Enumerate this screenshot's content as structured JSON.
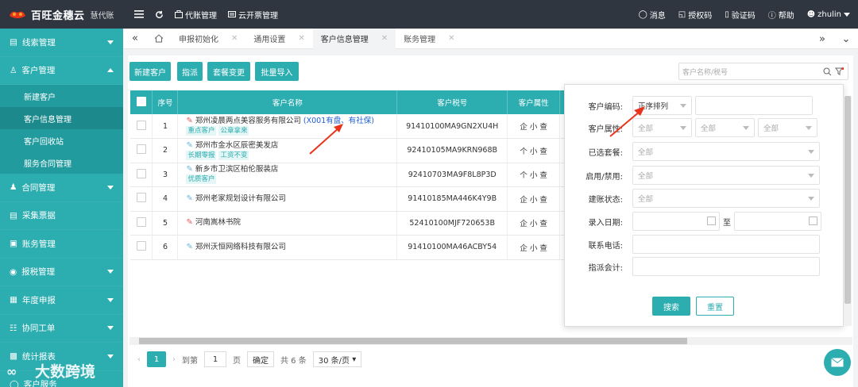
{
  "brand": {
    "name": "百旺金穗云",
    "sub": "慧代账"
  },
  "topnav": [
    {
      "icon": "menu-icon",
      "label": ""
    },
    {
      "icon": "refresh-icon",
      "label": ""
    },
    {
      "icon": "briefcase-icon",
      "label": "代账管理"
    },
    {
      "icon": "invoice-icon",
      "label": "云开票管理"
    }
  ],
  "topright": {
    "messages": "消息",
    "auth_code": "授权码",
    "verify_code": "验证码",
    "help": "帮助",
    "user": "zhulin"
  },
  "sidebar": {
    "items": [
      {
        "label": "线索管理",
        "icon": "clue-icon"
      },
      {
        "label": "客户管理",
        "icon": "user-group-icon",
        "expanded": true
      },
      {
        "label": "合同管理",
        "icon": "contract-icon"
      },
      {
        "label": "采集票据",
        "icon": "ticket-icon"
      },
      {
        "label": "账务管理",
        "icon": "ledger-icon"
      },
      {
        "label": "报税管理",
        "icon": "tax-icon"
      },
      {
        "label": "年度申报",
        "icon": "calendar-icon"
      },
      {
        "label": "协同工单",
        "icon": "workorder-icon"
      },
      {
        "label": "统计报表",
        "icon": "chart-icon"
      },
      {
        "label": "客户服务",
        "icon": "service-icon"
      }
    ],
    "subitems": [
      "新建客户",
      "客户信息管理",
      "客户回收站",
      "服务合同管理"
    ]
  },
  "tabs": [
    {
      "label": "申报初始化"
    },
    {
      "label": "通用设置"
    },
    {
      "label": "客户信息管理",
      "active": true
    },
    {
      "label": "账务管理"
    }
  ],
  "toolbar": {
    "new_customer": "新建客户",
    "assign": "指派",
    "package_change": "套餐变更",
    "batch_import": "批量导入",
    "search_placeholder": "客户名称/税号"
  },
  "table": {
    "headers": [
      "序号",
      "客户名称",
      "客户税号",
      "客户属性"
    ],
    "rows": [
      {
        "no": "1",
        "name": "郑州凌晨两点美容服务有限公司",
        "extra": "(X001有盘、有社保)",
        "tags": [
          "重点客户",
          "公章拿来"
        ],
        "tax": "91410100MA9GN2XU4H",
        "attr": "企 小 查",
        "icon": "red"
      },
      {
        "no": "2",
        "name": "郑州市金水区辰密美发店",
        "extra": "",
        "tags": [
          "长期零报",
          "工资不变"
        ],
        "tax": "92410105MA9KRN968B",
        "attr": "个 小 查",
        "icon": "blue"
      },
      {
        "no": "3",
        "name": "新乡市卫滨区柏伦服装店",
        "extra": "",
        "tags": [
          "优质客户"
        ],
        "tax": "92410703MA9F8L8P3D",
        "attr": "个 小 查",
        "icon": "blue"
      },
      {
        "no": "4",
        "name": "郑州老家规划设计有限公司",
        "extra": "",
        "tags": [],
        "tax": "91410185MA446K4Y9B",
        "attr": "企 小 查",
        "icon": "blue"
      },
      {
        "no": "5",
        "name": "河南嵩林书院",
        "extra": "",
        "tags": [],
        "tax": "52410100MJF720653B",
        "attr": "企 小 查",
        "icon": "red"
      },
      {
        "no": "6",
        "name": "郑州沃恒网络科技有限公司",
        "extra": "",
        "tags": [],
        "tax": "91410100MA46ACBY54",
        "attr": "企 小 查",
        "icon": "blue"
      }
    ]
  },
  "filter": {
    "code_label": "客户编码:",
    "code_sort": "正序排列",
    "attr_label": "客户属性:",
    "all": "全部",
    "package_label": "已选套餐:",
    "status_label": "启用/禁用:",
    "account_label": "建账状态:",
    "date_label": "录入日期:",
    "to": "至",
    "phone_label": "联系电话:",
    "accountant_label": "指派会计:",
    "search": "搜索",
    "reset": "重置"
  },
  "pager": {
    "page": "1",
    "goto": "到第",
    "page_input": "1",
    "page_unit": "页",
    "confirm": "确定",
    "total": "共 6 条",
    "per_page": "30 条/页"
  },
  "watermark": "大数跨境",
  "colors": {
    "accent": "#2cadb0",
    "topbar": "#2f3640",
    "arrow": "#e8341c"
  }
}
